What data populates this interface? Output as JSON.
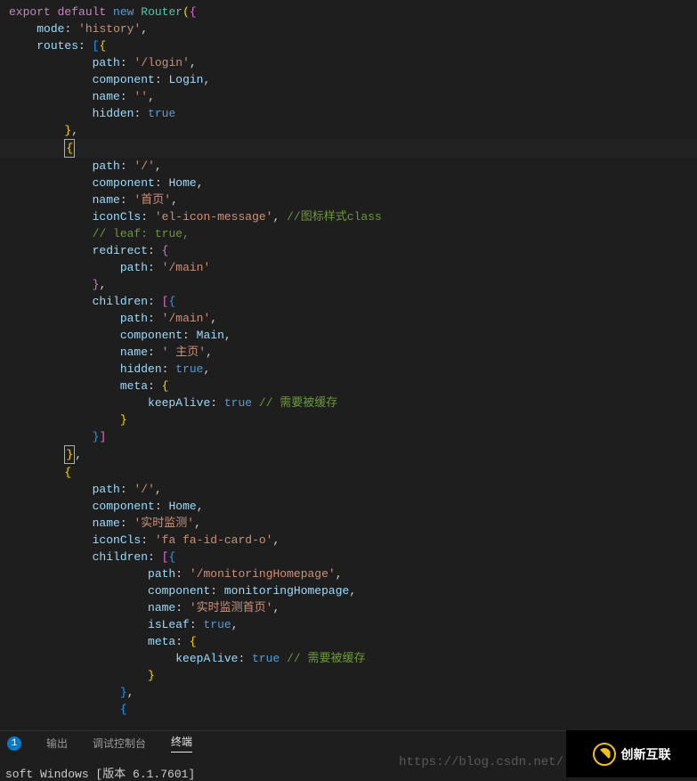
{
  "code": {
    "kw_export": "export",
    "kw_default": "default",
    "kw_new": "new",
    "cls_router": "Router",
    "paren_open": "(",
    "brace_open": "{",
    "brace_close": "}",
    "bracket_open": "[",
    "bracket_close": "]",
    "prop_mode": "mode",
    "colon": ":",
    "comma": ",",
    "val_history": "'history'",
    "prop_routes": "routes",
    "prop_path": "path",
    "val_login": "'/login'",
    "prop_component": "component",
    "id_login": "Login",
    "prop_name": "name",
    "val_empty": "''",
    "prop_hidden": "hidden",
    "val_true": "true",
    "val_slash": "'/'",
    "id_home": "Home",
    "val_shouye": "'首页'",
    "prop_iconcls": "iconCls",
    "val_elicon": "'el-icon-message'",
    "cmt_icon": "//图标样式class",
    "cmt_leaf": "// leaf: true,",
    "prop_redirect": "redirect",
    "val_main": "'/main'",
    "prop_children": "children",
    "id_main": "Main",
    "val_zhuye": "' 主页'",
    "prop_meta": "meta",
    "prop_keepalive": "keepAlive",
    "cmt_cache": "// 需要被缓存",
    "val_shishi": "'实时监测'",
    "val_faid": "'fa fa-id-card-o'",
    "val_monitor": "'/monitoringHomepage'",
    "id_monitor": "monitoringHomepage",
    "val_monitor_name": "'实时监测首页'",
    "prop_isleaf": "isLeaf"
  },
  "tabs": {
    "badge": "1",
    "output": "输出",
    "debug": "调试控制台",
    "terminal": "终端"
  },
  "terminal": {
    "line": "soft Windows [版本 6.1.7601]"
  },
  "watermark": {
    "url": "https://blog.csdn.net/"
  },
  "logo": {
    "text": "创新互联"
  }
}
